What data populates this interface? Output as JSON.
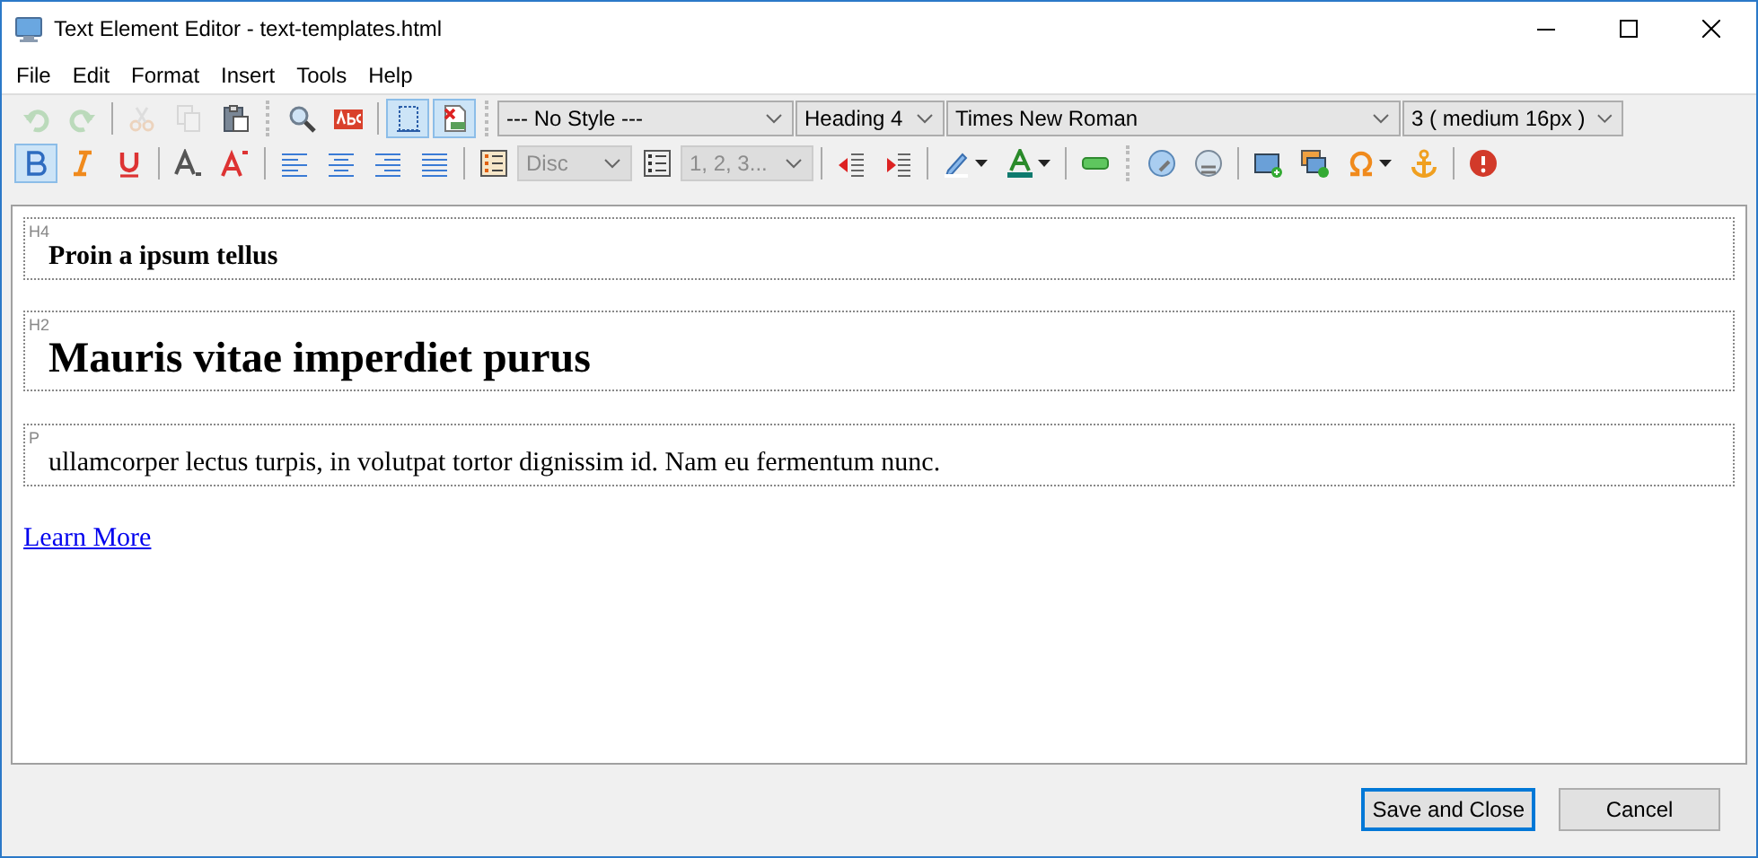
{
  "window": {
    "title": "Text Element Editor - text-templates.html"
  },
  "menu": [
    "File",
    "Edit",
    "Format",
    "Insert",
    "Tools",
    "Help"
  ],
  "toolbar_rows": [
    [
      {
        "kind": "button",
        "disabled": true,
        "on": false
      },
      {
        "kind": "button",
        "disabled": true,
        "on": false
      },
      {
        "kind": "separator"
      },
      {
        "kind": "button",
        "disabled": true,
        "on": false
      },
      {
        "kind": "button",
        "disabled": true,
        "on": false
      },
      {
        "kind": "button",
        "disabled": false,
        "on": false
      },
      {
        "kind": "grip"
      },
      {
        "kind": "button",
        "disabled": false,
        "on": false
      },
      {
        "kind": "button",
        "disabled": false,
        "on": false
      },
      {
        "kind": "separator"
      },
      {
        "kind": "button",
        "disabled": false,
        "on": true
      },
      {
        "kind": "button",
        "disabled": false,
        "on": true
      },
      {
        "kind": "grip"
      },
      {
        "kind": "select",
        "value": "--- No Style ---",
        "disabled": false
      },
      {
        "kind": "select",
        "value": "Heading 4",
        "disabled": false
      },
      {
        "kind": "select",
        "value": "Times New Roman",
        "disabled": false
      },
      {
        "kind": "select",
        "value": "3 ( medium 16px )",
        "disabled": false
      }
    ],
    [
      {
        "kind": "button",
        "disabled": false,
        "on": true
      },
      {
        "kind": "button",
        "disabled": false,
        "on": false
      },
      {
        "kind": "button",
        "disabled": false,
        "on": false
      },
      {
        "kind": "separator"
      },
      {
        "kind": "button",
        "disabled": false,
        "on": false
      },
      {
        "kind": "button",
        "disabled": false,
        "on": false
      },
      {
        "kind": "separator"
      },
      {
        "kind": "button",
        "disabled": false,
        "on": false
      },
      {
        "kind": "button",
        "disabled": false,
        "on": false
      },
      {
        "kind": "button",
        "disabled": false,
        "on": false
      },
      {
        "kind": "button",
        "disabled": false,
        "on": false
      },
      {
        "kind": "separator"
      },
      {
        "kind": "button",
        "disabled": false,
        "on": false
      },
      {
        "kind": "select",
        "value": "Disc",
        "disabled": true
      },
      {
        "kind": "button",
        "disabled": false,
        "on": false
      },
      {
        "kind": "select",
        "value": "1, 2, 3...",
        "disabled": true
      },
      {
        "kind": "separator"
      },
      {
        "kind": "button",
        "disabled": false,
        "on": false
      },
      {
        "kind": "button",
        "disabled": false,
        "on": false
      },
      {
        "kind": "separator"
      },
      {
        "kind": "split",
        "disabled": false,
        "on": false
      },
      {
        "kind": "split",
        "disabled": false,
        "on": false
      },
      {
        "kind": "separator"
      },
      {
        "kind": "button",
        "disabled": false,
        "on": false
      },
      {
        "kind": "grip"
      },
      {
        "kind": "button",
        "disabled": false,
        "on": false
      },
      {
        "kind": "button",
        "disabled": false,
        "on": false
      },
      {
        "kind": "separator"
      },
      {
        "kind": "button",
        "disabled": false,
        "on": false
      },
      {
        "kind": "button",
        "disabled": false,
        "on": false
      },
      {
        "kind": "split",
        "disabled": false,
        "on": false
      },
      {
        "kind": "button",
        "disabled": false,
        "on": false
      },
      {
        "kind": "separator"
      },
      {
        "kind": "button",
        "disabled": false,
        "on": false
      }
    ]
  ],
  "blocks": [
    {
      "tag": "H4",
      "kind": "h4",
      "text": "Proin a ipsum tellus"
    },
    {
      "tag": "H2",
      "kind": "h2",
      "text": "Mauris vitae imperdiet purus"
    },
    {
      "tag": "P",
      "kind": "p",
      "text": "ullamcorper lectus turpis, in volutpat tortor dignissim id. Nam eu fermentum nunc."
    }
  ],
  "link": "Learn More",
  "buttons": [
    {
      "label": "Save and Close",
      "default": true
    },
    {
      "label": "Cancel",
      "default": false
    }
  ]
}
